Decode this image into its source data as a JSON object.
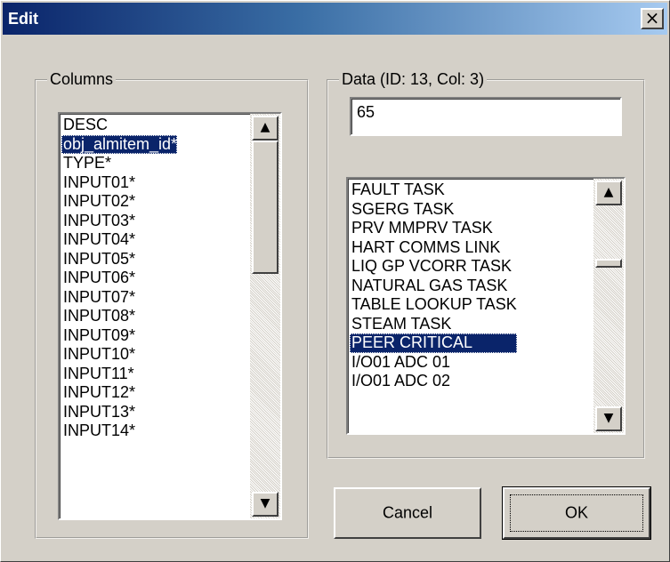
{
  "window": {
    "title": "Edit",
    "close_glyph": "×"
  },
  "columns_group": {
    "legend": "Columns",
    "items": [
      "DESC",
      "obj_almitem_id*",
      "TYPE*",
      "INPUT01*",
      "INPUT02*",
      "INPUT03*",
      "INPUT04*",
      "INPUT05*",
      "INPUT06*",
      "INPUT07*",
      "INPUT08*",
      "INPUT09*",
      "INPUT10*",
      "INPUT11*",
      "INPUT12*",
      "INPUT13*",
      "INPUT14*"
    ],
    "selected_index": 1
  },
  "data_group": {
    "legend": "Data (ID: 13, Col: 3)",
    "value": "65",
    "items": [
      "FAULT TASK",
      "SGERG TASK",
      "PRV MMPRV TASK",
      "HART COMMS LINK",
      "LIQ GP VCORR TASK",
      "NATURAL GAS TASK",
      "TABLE LOOKUP TASK",
      "STEAM TASK",
      "PEER CRITICAL",
      "I/O01 ADC 01",
      "I/O01 ADC 02"
    ],
    "selected_index": 8
  },
  "buttons": {
    "cancel": "Cancel",
    "ok": "OK"
  },
  "scroll": {
    "up_glyph": "▲",
    "down_glyph": "▼"
  }
}
